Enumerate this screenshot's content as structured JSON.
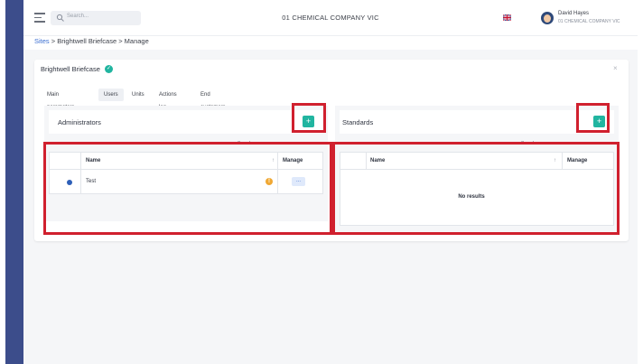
{
  "topbar": {
    "search_placeholder": "Search...",
    "company_title": "01 CHEMICAL COMPANY VIC",
    "user_name": "David Hayes",
    "user_company": "01 CHEMICAL COMPANY VIC"
  },
  "breadcrumb": {
    "sites": "Sites",
    "sep1": " > ",
    "site": "Brightwell Briefcase",
    "sep2": " > ",
    "current": "Manage"
  },
  "card": {
    "title": "Brightwell Briefcase",
    "close": "×"
  },
  "tabs": [
    "Main parameters",
    "Users",
    "Units",
    "Actions log",
    "End customers"
  ],
  "active_tab": "Users",
  "administrators": {
    "title": "Administrators",
    "add_label": "+",
    "search_label": "Search",
    "columns": {
      "name": "Name",
      "manage": "Manage"
    },
    "rows": [
      {
        "name": "Test",
        "manage_label": "..."
      }
    ]
  },
  "standards": {
    "title": "Standards",
    "add_label": "+",
    "search_label": "Search",
    "columns": {
      "name": "Name",
      "manage": "Manage"
    },
    "empty_text": "No results"
  },
  "colors": {
    "sidebar": "#3c4d8b",
    "accent": "#21b5a0",
    "link": "#3c6fd1",
    "highlight": "#d0202e",
    "warning": "#f0a833"
  },
  "icons": [
    "hamburger-icon",
    "search-icon",
    "uk-flag-icon",
    "check-icon",
    "close-icon",
    "info-icon",
    "warning-icon",
    "sort-icon"
  ]
}
